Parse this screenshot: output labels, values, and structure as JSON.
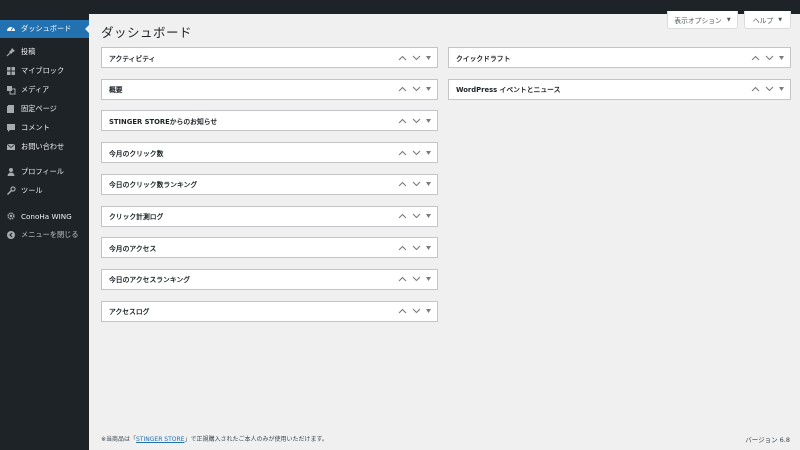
{
  "sidebar": {
    "items": [
      {
        "label": "ダッシュボード",
        "icon": "dashboard-icon"
      },
      {
        "label": "投稿",
        "icon": "pin-icon"
      },
      {
        "label": "マイブロック",
        "icon": "blocks-icon"
      },
      {
        "label": "メディア",
        "icon": "media-icon"
      },
      {
        "label": "固定ページ",
        "icon": "page-icon"
      },
      {
        "label": "コメント",
        "icon": "comment-icon"
      },
      {
        "label": "お問い合わせ",
        "icon": "mail-icon"
      },
      {
        "label": "プロフィール",
        "icon": "user-icon"
      },
      {
        "label": "ツール",
        "icon": "wrench-icon"
      },
      {
        "label": "ConoHa WING",
        "icon": "gear-icon"
      },
      {
        "label": "メニューを閉じる",
        "icon": "collapse-icon"
      }
    ]
  },
  "header": {
    "title": "ダッシュボード",
    "screen_options": "表示オプション",
    "help": "ヘルプ"
  },
  "widgets": {
    "left": [
      "アクティビティ",
      "概要",
      "STINGER STOREからのお知らせ",
      "今月のクリック数",
      "今日のクリック数ランキング",
      "クリック計測ログ",
      "今月のアクセス",
      "今日のアクセスランキング",
      "アクセスログ"
    ],
    "right": [
      "クイックドラフト",
      "WordPress イベントとニュース"
    ]
  },
  "footer": {
    "prefix": "※当商品は「",
    "link": "STINGER STORE",
    "suffix": "」で正規購入されたご本人のみが使用いただけます。",
    "version": "バージョン 6.8"
  },
  "colors": {
    "sidebar_bg": "#1d2327",
    "accent": "#2271b1",
    "page_bg": "#f0f0f1"
  }
}
